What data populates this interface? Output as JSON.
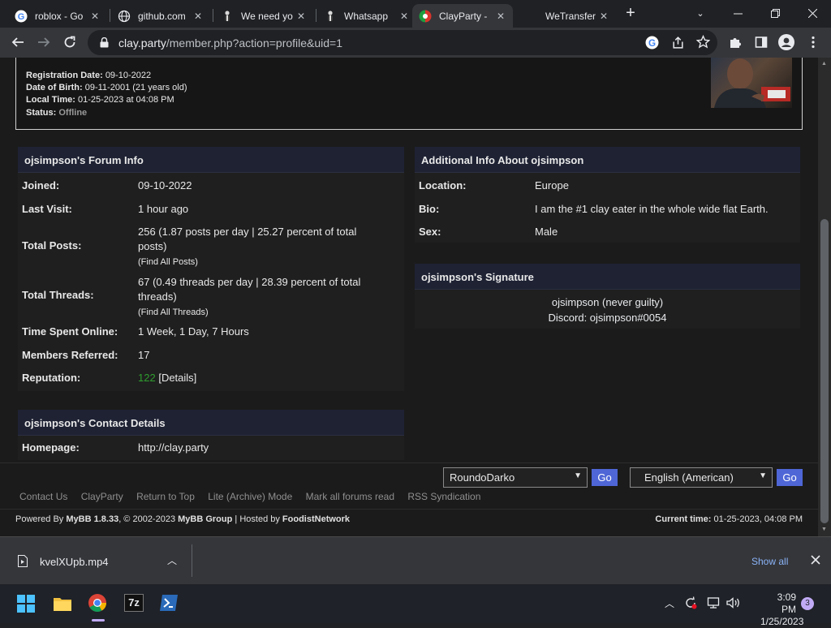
{
  "browser": {
    "tabs": [
      {
        "title": "roblox - Go",
        "icon": "google-g-icon"
      },
      {
        "title": "github.com",
        "icon": "globe-icon"
      },
      {
        "title": "We need yo",
        "icon": "person-icon"
      },
      {
        "title": "Whatsapp",
        "icon": "person-icon"
      },
      {
        "title": "ClayParty -",
        "icon": "clayparty-logo-icon"
      },
      {
        "title": "WeTransfer",
        "icon": "wetransfer-icon"
      }
    ],
    "close_glyph": "✕",
    "new_tab_glyph": "+",
    "url_host": "clay.party",
    "url_path": "/member.php?action=profile&uid=1"
  },
  "profile": {
    "lines": [
      {
        "label": "Registration Date:",
        "value": "09-10-2022"
      },
      {
        "label": "Date of Birth:",
        "value": "09-11-2001 (21 years old)"
      },
      {
        "label": "Local Time:",
        "value": "01-25-2023 at 04:08 PM"
      },
      {
        "label": "Status:",
        "value": "Offline"
      }
    ]
  },
  "forum_info": {
    "title": "ojsimpson's Forum Info",
    "joined_label": "Joined:",
    "joined": "09-10-2022",
    "last_visit_label": "Last Visit:",
    "last_visit": "1 hour ago",
    "posts_label": "Total Posts:",
    "posts_1": "256 (1.87 posts per day | 25.27 percent of total",
    "posts_2": "posts)",
    "posts_link": "(Find All Posts)",
    "threads_label": "Total Threads:",
    "threads_1": "67 (0.49 threads per day | 28.39 percent of total",
    "threads_2": "threads)",
    "threads_link": "(Find All Threads)",
    "online_label": "Time Spent Online:",
    "online": "1 Week, 1 Day, 7 Hours",
    "referred_label": "Members Referred:",
    "referred": "17",
    "rep_label": "Reputation:",
    "rep": "122",
    "rep_details": "[Details]"
  },
  "contact": {
    "title": "ojsimpson's Contact Details",
    "homepage_label": "Homepage:",
    "homepage": "http://clay.party"
  },
  "additional": {
    "title": "Additional Info About ojsimpson",
    "location_label": "Location:",
    "location": "Europe",
    "bio_label": "Bio:",
    "bio": "I am the #1 clay eater in the whole wide flat Earth.",
    "sex_label": "Sex:",
    "sex": "Male"
  },
  "signature": {
    "title": "ojsimpson's Signature",
    "line1": "ojsimpson (never guilty)",
    "line2": "Discord: ojsimpson#0054"
  },
  "footer": {
    "theme": "RoundoDarko",
    "language": "English (American)",
    "go": "Go",
    "links": [
      "Contact Us",
      "ClayParty",
      "Return to Top",
      "Lite (Archive) Mode",
      "Mark all forums read",
      "RSS Syndication"
    ],
    "powered_prefix": "Powered By ",
    "powered_mybb": "MyBB 1.8.33",
    "powered_mid": ", © 2002-2023 ",
    "powered_group": "MyBB Group",
    "powered_hosted": " | Hosted by ",
    "powered_host": "FoodistNetwork",
    "current_time_label": "Current time:",
    "current_time": "01-25-2023, 04:08 PM"
  },
  "download": {
    "filename": "kvelXUpb.mp4",
    "show_all": "Show all"
  },
  "taskbar": {
    "time": "3:09 PM",
    "date": "1/25/2023",
    "notifications": "3",
    "sevenzip_label": "7z"
  },
  "colors": {
    "accent": "#4e66d6",
    "reputation": "#2f9e2f",
    "panel_header": "#1e2233"
  }
}
